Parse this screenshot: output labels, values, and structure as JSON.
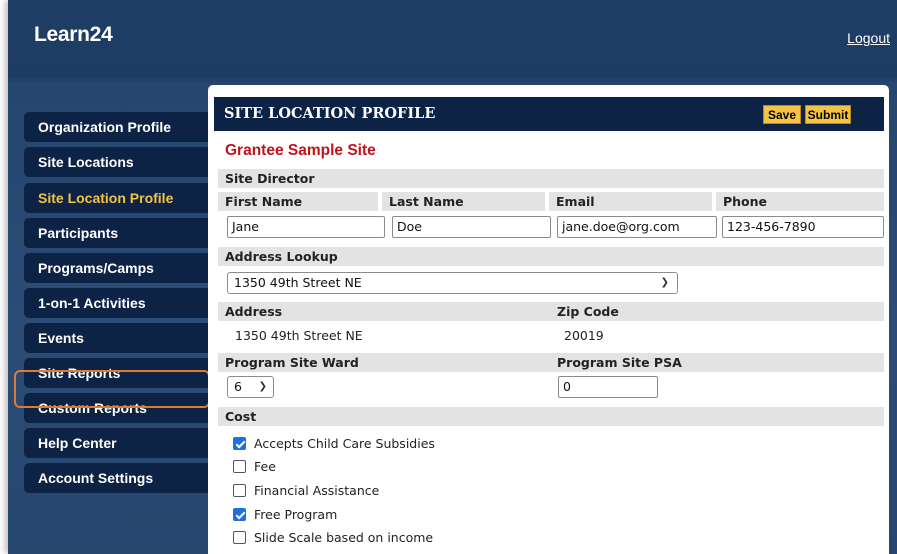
{
  "app": {
    "title": "Learn24",
    "logout_label": "Logout"
  },
  "nav": {
    "items": [
      {
        "label": "Organization Profile"
      },
      {
        "label": "Site Locations"
      },
      {
        "label": "Site Location Profile",
        "active": true
      },
      {
        "label": "Participants"
      },
      {
        "label": "Programs/Camps"
      },
      {
        "label": "1-on-1 Activities"
      },
      {
        "label": "Events"
      },
      {
        "label": "Site Reports",
        "highlighted": true
      },
      {
        "label": "Custom Reports"
      },
      {
        "label": "Help Center"
      },
      {
        "label": "Account Settings"
      }
    ]
  },
  "panel": {
    "title": "SITE LOCATION PROFILE",
    "save_label": "Save",
    "submit_label": "Submit",
    "site_name": "Grantee Sample Site"
  },
  "director": {
    "section_label": "Site Director",
    "first_name_label": "First Name",
    "last_name_label": "Last Name",
    "email_label": "Email",
    "phone_label": "Phone",
    "first_name": "Jane",
    "last_name": "Doe",
    "email": "jane.doe@org.com",
    "phone": "123-456-7890"
  },
  "address": {
    "lookup_label": "Address Lookup",
    "lookup_value": "1350 49th Street NE",
    "address_label": "Address",
    "address_value": "1350 49th Street NE",
    "zip_label": "Zip Code",
    "zip_value": "20019"
  },
  "ward": {
    "ward_label": "Program Site Ward",
    "ward_value": "6",
    "psa_label": "Program Site PSA",
    "psa_value": "0"
  },
  "cost": {
    "section_label": "Cost",
    "options": [
      {
        "label": "Accepts Child Care Subsidies",
        "checked": true
      },
      {
        "label": "Fee",
        "checked": false
      },
      {
        "label": "Financial Assistance",
        "checked": false
      },
      {
        "label": "Free Program",
        "checked": true
      },
      {
        "label": "Slide Scale based on income",
        "checked": false
      }
    ]
  },
  "colors": {
    "nav_bg": "#0d2346",
    "active_nav": "#f5c343",
    "accent_button": "#f5c343",
    "site_name": "#c0141a",
    "highlight_border": "#e07a2e"
  }
}
